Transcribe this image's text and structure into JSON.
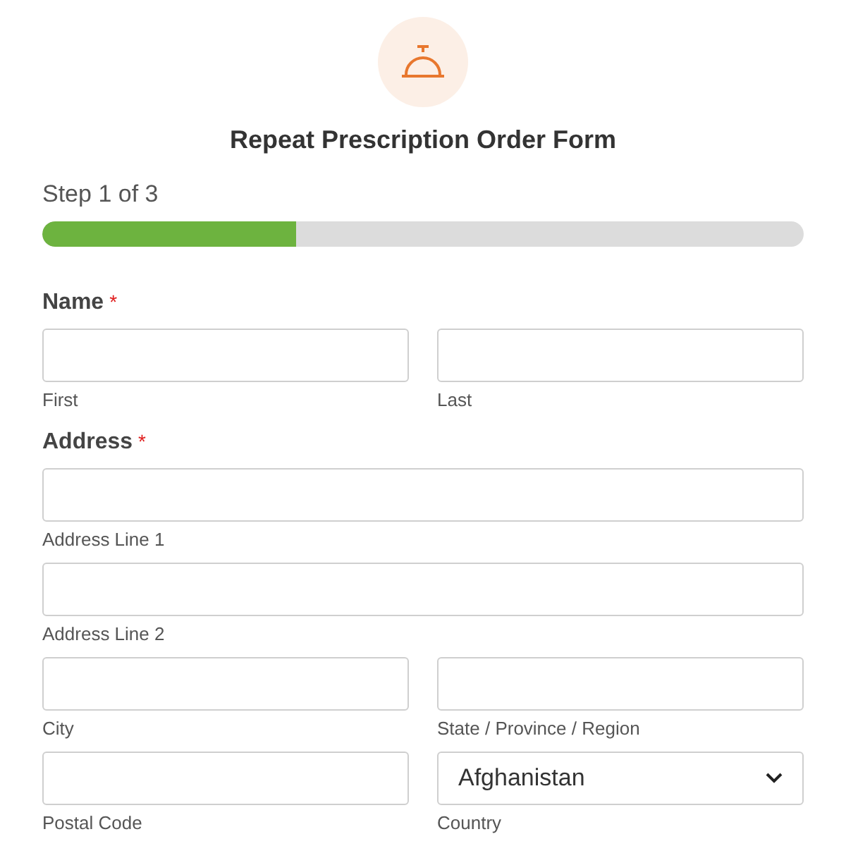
{
  "form": {
    "title": "Repeat Prescription Order Form"
  },
  "progress": {
    "label": "Step 1 of 3",
    "level": 0.333
  },
  "fields": [
    {
      "label": "Name",
      "required": true,
      "rows": [
        [
          {
            "kind": "text",
            "sublabel": "First"
          },
          {
            "kind": "text",
            "sublabel": "Last"
          }
        ]
      ]
    },
    {
      "label": "Address",
      "required": true,
      "rows": [
        [
          {
            "kind": "text",
            "sublabel": "Address Line 1"
          }
        ],
        [
          {
            "kind": "text",
            "sublabel": "Address Line 2"
          }
        ],
        [
          {
            "kind": "text",
            "sublabel": "City"
          },
          {
            "kind": "text",
            "sublabel": "State / Province / Region"
          }
        ],
        [
          {
            "kind": "text",
            "sublabel": "Postal Code"
          },
          {
            "kind": "select",
            "value": "Afghanistan",
            "sublabel": "Country"
          }
        ]
      ]
    }
  ],
  "required_mark": "*"
}
